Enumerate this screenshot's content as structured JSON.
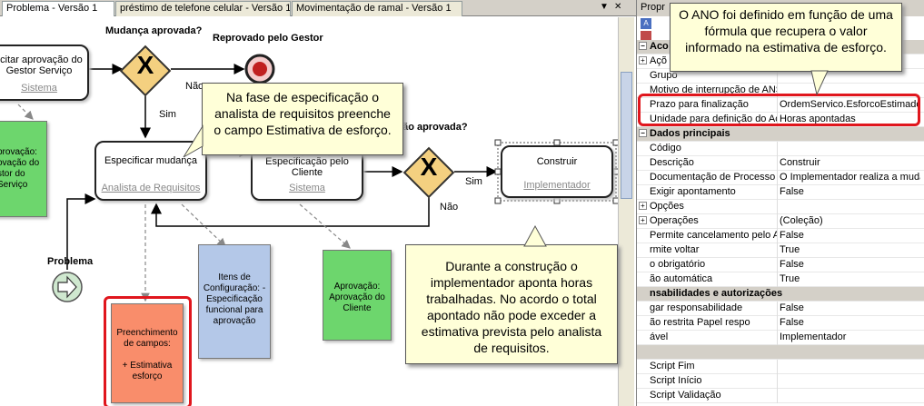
{
  "tabs": [
    {
      "label": "Problema - Versão 1"
    },
    {
      "label": "préstimo de telefone celular - Versão 1"
    },
    {
      "label": "Movimentação de ramal - Versão 1"
    }
  ],
  "tab_controls": {
    "dropdown": "▼",
    "close": "✕"
  },
  "diagram": {
    "task_solicitar": {
      "title": "licitar aprovação do Gestor Serviço",
      "role": "Sistema"
    },
    "gateway1_label": "Mudança aprovada?",
    "gateway1_glyph": "X",
    "reprovado_label": "Reprovado pelo Gestor",
    "nao1": "Não",
    "sim1": "Sim",
    "task_especificar": {
      "title": "Especificar mudança",
      "role": "Analista de Requisitos"
    },
    "task_solicitar_espec": {
      "title": "Solicitar aprovação da Especificação pelo Cliente",
      "role": "Sistema"
    },
    "gateway2_label": "ficação aprovada?",
    "gateway2_glyph": "X",
    "sim2": "Sim",
    "nao2": "Não",
    "task_construir": {
      "title": "Construir",
      "role": "Implementador"
    },
    "problema_label": "Problema",
    "doc_aprovacao_left": "provação: ovação do stor do Serviço",
    "doc_itens": "Itens de Configuração: - Especificação funcional para aprovação",
    "doc_aprovacao_cliente": "Aprovação: Aprovação do Cliente",
    "doc_preenchimento_1": "Preenchimento de campos:",
    "doc_preenchimento_2": "+ Estimativa esforço"
  },
  "callouts": {
    "top": "O ANO foi definido em função de uma fórmula que recupera o valor informado na estimativa de esforço.",
    "middle": "Na fase de especificação o analista de requisitos preenche o campo Estimativa de esforço.",
    "bottom": "Durante a construção o implementador aponta horas trabalhadas. No acordo o total apontado não pode exceder a estimativa prevista pelo analista de requisitos."
  },
  "properties": {
    "title": "Propr",
    "rows": [
      {
        "type": "cat",
        "k": "Aco",
        "exp": "−"
      },
      {
        "type": "row",
        "k": "Açõ",
        "v": "",
        "exp": "+"
      },
      {
        "type": "row",
        "k": "Grupo",
        "v": ""
      },
      {
        "type": "row",
        "k": "Motivo de interrupção de ANS",
        "v": ""
      },
      {
        "type": "row",
        "k": "Prazo para finalização",
        "v": "OrdemServico.EsforcoEstimado"
      },
      {
        "type": "row",
        "k": "Unidade para definição do Aco",
        "v": "Horas apontadas"
      },
      {
        "type": "cat",
        "k": "Dados principais",
        "exp": "−"
      },
      {
        "type": "row",
        "k": "Código",
        "v": ""
      },
      {
        "type": "row",
        "k": "Descrição",
        "v": "Construir"
      },
      {
        "type": "row",
        "k": "Documentação de Processo",
        "v": "O Implementador realiza a mudar"
      },
      {
        "type": "row",
        "k": "Exigir apontamento",
        "v": "False"
      },
      {
        "type": "row",
        "k": "Opções",
        "v": "",
        "exp": "+"
      },
      {
        "type": "row",
        "k": "Operações",
        "v": "(Coleção)",
        "exp": "+"
      },
      {
        "type": "row",
        "k": "Permite cancelamento pelo Au",
        "v": "False"
      },
      {
        "type": "row",
        "k": "rmite voltar",
        "v": "True"
      },
      {
        "type": "row",
        "k": "o obrigatório",
        "v": "False"
      },
      {
        "type": "row",
        "k": "ão automática",
        "v": "True"
      },
      {
        "type": "cat",
        "k": "nsabilidades e autorizações"
      },
      {
        "type": "row",
        "k": "gar responsabilidade",
        "v": "False"
      },
      {
        "type": "row",
        "k": "ão restrita Papel respo",
        "v": "False"
      },
      {
        "type": "row",
        "k": "ável",
        "v": "Implementador"
      },
      {
        "type": "cat",
        "k": ""
      },
      {
        "type": "row",
        "k": "Script Fim",
        "v": ""
      },
      {
        "type": "row",
        "k": "Script Início",
        "v": ""
      },
      {
        "type": "row",
        "k": "Script Validação",
        "v": ""
      }
    ]
  },
  "colors": {
    "highlight": "#e0161d",
    "callout_bg": "#ffffd8",
    "gateway": "#f4d080"
  }
}
